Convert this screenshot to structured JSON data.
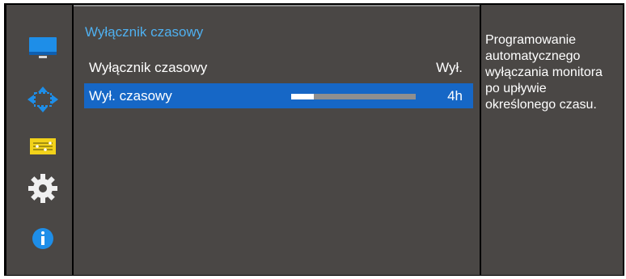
{
  "sidebar": {
    "icons": [
      "monitor-icon",
      "resize-arrows-icon",
      "menu-list-icon",
      "gear-icon",
      "info-icon"
    ]
  },
  "menu": {
    "title": "Wyłącznik czasowy",
    "rows": [
      {
        "label": "Wyłącznik czasowy",
        "value": "Wył."
      },
      {
        "label": "Wył. czasowy",
        "value": "4h",
        "slider_fraction": 0.18
      }
    ]
  },
  "info": {
    "text": "Programowanie\nautomatycznego\nwyłączania monitora\npo upływie\nokreślonego czasu."
  },
  "colors": {
    "accent": "#4fb0f0",
    "selected_row": "#1667c6",
    "panel_bg": "#4a4745"
  }
}
